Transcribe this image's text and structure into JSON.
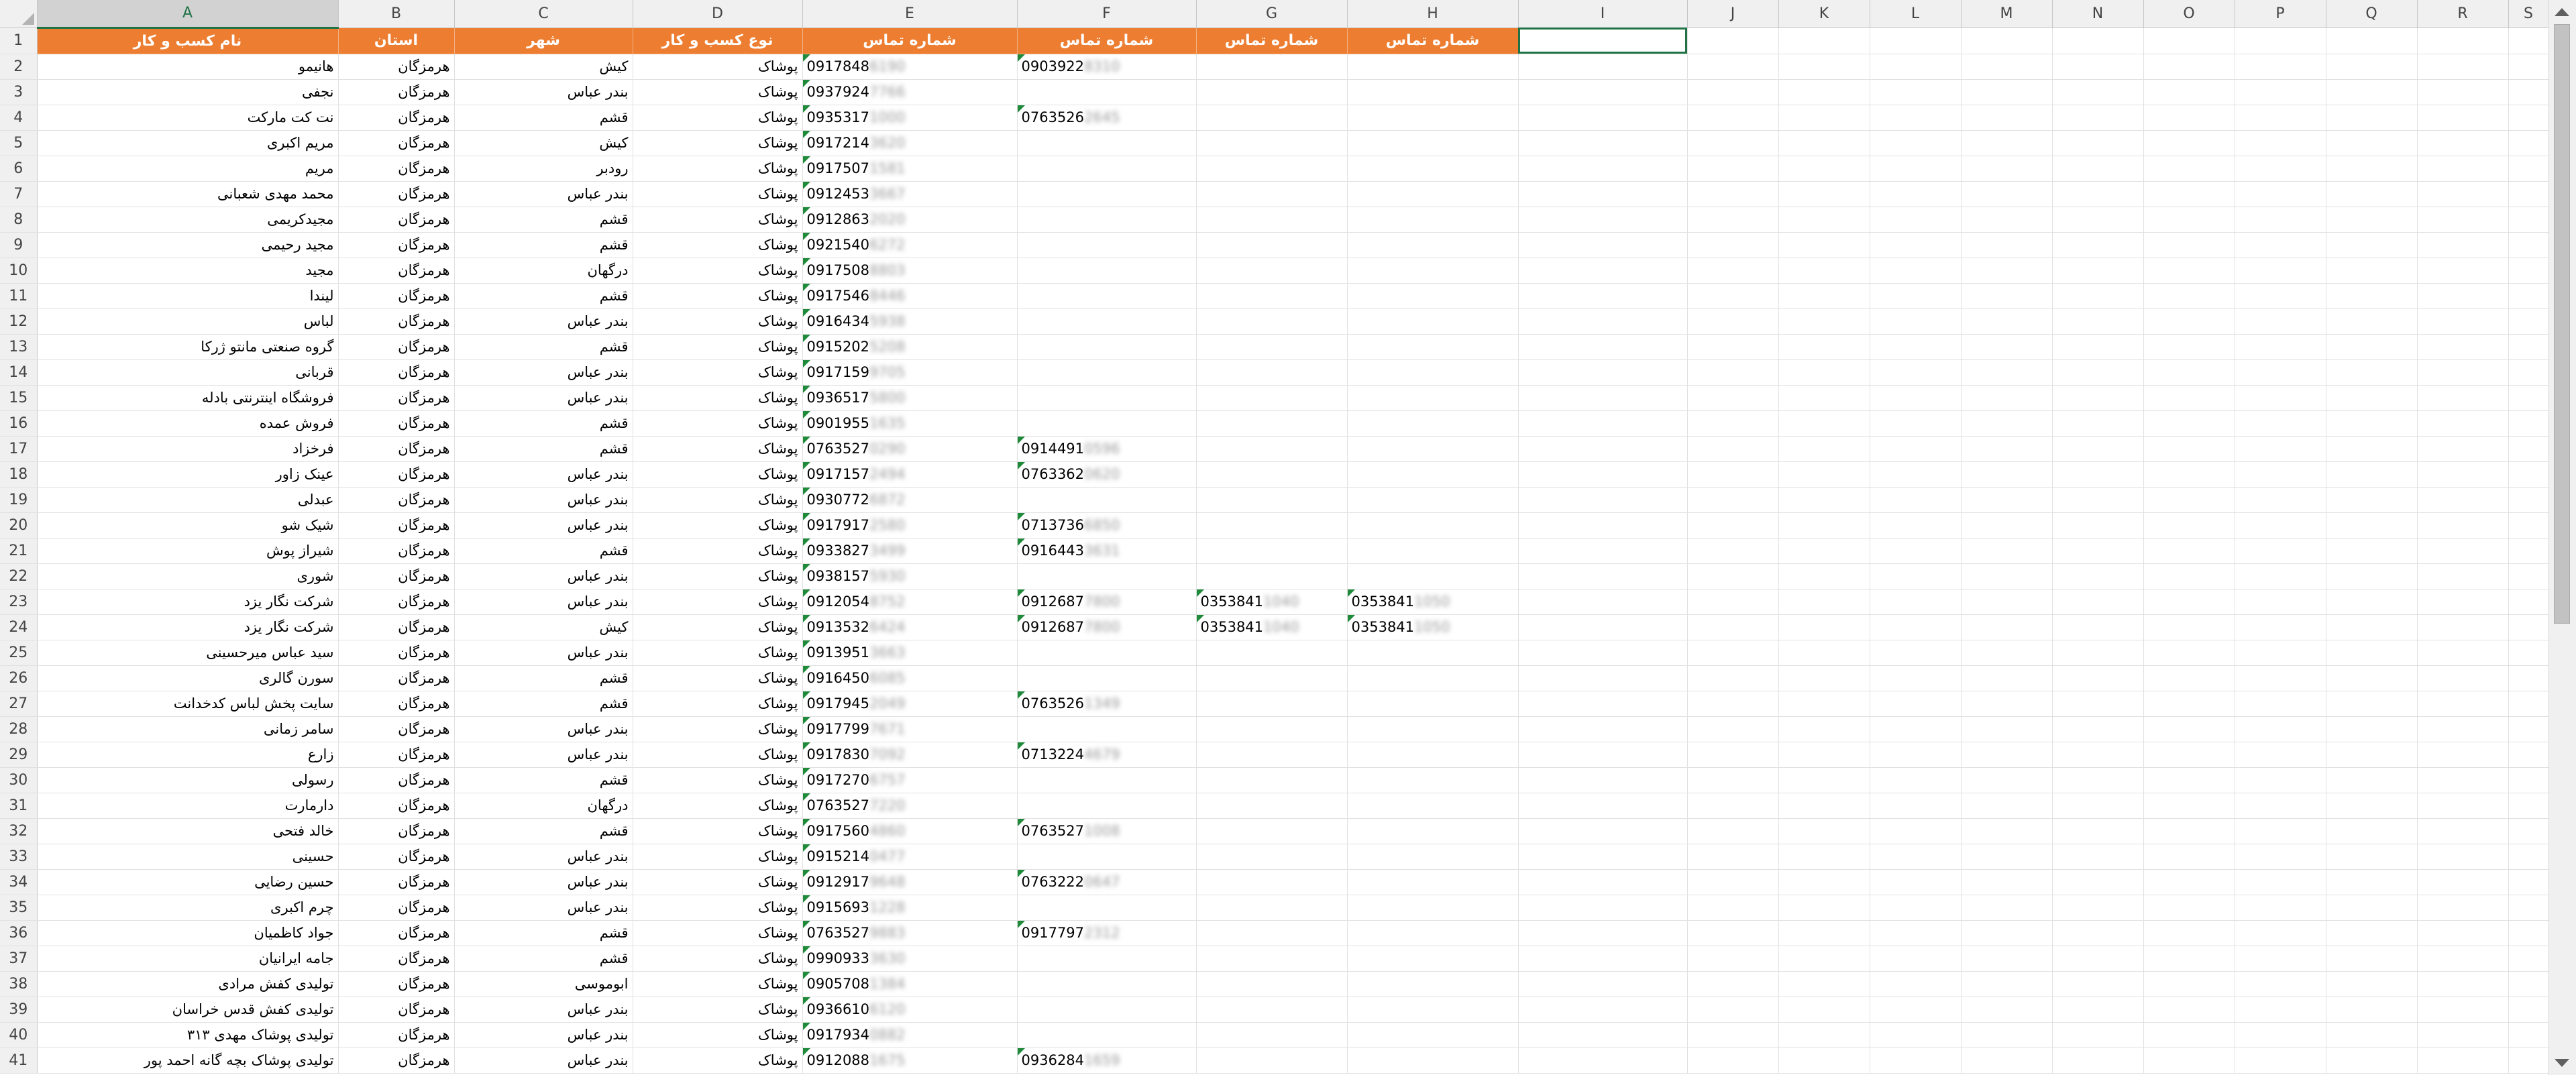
{
  "columns": [
    "A",
    "B",
    "C",
    "D",
    "E",
    "F",
    "G",
    "H",
    "I",
    "J",
    "K",
    "L",
    "M",
    "N",
    "O",
    "P",
    "Q",
    "R",
    "S"
  ],
  "selected_column": "A",
  "header_row": {
    "name": "نام کسب و کار",
    "province": "استان",
    "city": "شهر",
    "business_type": "نوع کسب و کار",
    "phone1": "شماره تماس",
    "phone2": "شماره تماس",
    "phone3": "شماره تماس",
    "phone4": "شماره تماس"
  },
  "rows": [
    {
      "n": "2",
      "name": "هانیمو",
      "province": "هرمزگان",
      "city": "کیش",
      "type": "پوشاک",
      "p1": "0917848",
      "p1h": "6190",
      "p2": "0903922",
      "p2h": "8310",
      "p3": "",
      "p3h": "",
      "p4": "",
      "p4h": ""
    },
    {
      "n": "3",
      "name": "نجفی",
      "province": "هرمزگان",
      "city": "بندر عباس",
      "type": "پوشاک",
      "p1": "0937924",
      "p1h": "7766",
      "p2": "",
      "p2h": "",
      "p3": "",
      "p3h": "",
      "p4": "",
      "p4h": ""
    },
    {
      "n": "4",
      "name": "نت کت مارکت",
      "province": "هرمزگان",
      "city": "قشم",
      "type": "پوشاک",
      "p1": "0935317",
      "p1h": "1000",
      "p2": "0763526",
      "p2h": "2645",
      "p3": "",
      "p3h": "",
      "p4": "",
      "p4h": ""
    },
    {
      "n": "5",
      "name": "مریم اکبری",
      "province": "هرمزگان",
      "city": "کیش",
      "type": "پوشاک",
      "p1": "0917214",
      "p1h": "3620",
      "p2": "",
      "p2h": "",
      "p3": "",
      "p3h": "",
      "p4": "",
      "p4h": ""
    },
    {
      "n": "6",
      "name": "مریم",
      "province": "هرمزگان",
      "city": "رودبر",
      "type": "پوشاک",
      "p1": "0917507",
      "p1h": "1581",
      "p2": "",
      "p2h": "",
      "p3": "",
      "p3h": "",
      "p4": "",
      "p4h": ""
    },
    {
      "n": "7",
      "name": "محمد مهدی شعبانی",
      "province": "هرمزگان",
      "city": "بندر عباس",
      "type": "پوشاک",
      "p1": "0912453",
      "p1h": "3667",
      "p2": "",
      "p2h": "",
      "p3": "",
      "p3h": "",
      "p4": "",
      "p4h": ""
    },
    {
      "n": "8",
      "name": "مجیدکریمی",
      "province": "هرمزگان",
      "city": "قشم",
      "type": "پوشاک",
      "p1": "0912863",
      "p1h": "2020",
      "p2": "",
      "p2h": "",
      "p3": "",
      "p3h": "",
      "p4": "",
      "p4h": ""
    },
    {
      "n": "9",
      "name": "مجید رحیمی",
      "province": "هرمزگان",
      "city": "قشم",
      "type": "پوشاک",
      "p1": "0921540",
      "p1h": "6272",
      "p2": "",
      "p2h": "",
      "p3": "",
      "p3h": "",
      "p4": "",
      "p4h": ""
    },
    {
      "n": "10",
      "name": "مجید",
      "province": "هرمزگان",
      "city": "درگهان",
      "type": "پوشاک",
      "p1": "0917508",
      "p1h": "8803",
      "p2": "",
      "p2h": "",
      "p3": "",
      "p3h": "",
      "p4": "",
      "p4h": ""
    },
    {
      "n": "11",
      "name": "لیندا",
      "province": "هرمزگان",
      "city": "قشم",
      "type": "پوشاک",
      "p1": "0917546",
      "p1h": "8446",
      "p2": "",
      "p2h": "",
      "p3": "",
      "p3h": "",
      "p4": "",
      "p4h": ""
    },
    {
      "n": "12",
      "name": "لباس",
      "province": "هرمزگان",
      "city": "بندر عباس",
      "type": "پوشاک",
      "p1": "0916434",
      "p1h": "5938",
      "p2": "",
      "p2h": "",
      "p3": "",
      "p3h": "",
      "p4": "",
      "p4h": ""
    },
    {
      "n": "13",
      "name": "گروه صنعتی مانتو ژرکا",
      "province": "هرمزگان",
      "city": "قشم",
      "type": "پوشاک",
      "p1": "0915202",
      "p1h": "5208",
      "p2": "",
      "p2h": "",
      "p3": "",
      "p3h": "",
      "p4": "",
      "p4h": ""
    },
    {
      "n": "14",
      "name": "قربانی",
      "province": "هرمزگان",
      "city": "بندر عباس",
      "type": "پوشاک",
      "p1": "0917159",
      "p1h": "9705",
      "p2": "",
      "p2h": "",
      "p3": "",
      "p3h": "",
      "p4": "",
      "p4h": ""
    },
    {
      "n": "15",
      "name": "فروشگاه اینترنتی بادله",
      "province": "هرمزگان",
      "city": "بندر عباس",
      "type": "پوشاک",
      "p1": "0936517",
      "p1h": "5800",
      "p2": "",
      "p2h": "",
      "p3": "",
      "p3h": "",
      "p4": "",
      "p4h": ""
    },
    {
      "n": "16",
      "name": "فروش عمده",
      "province": "هرمزگان",
      "city": "قشم",
      "type": "پوشاک",
      "p1": "0901955",
      "p1h": "1635",
      "p2": "",
      "p2h": "",
      "p3": "",
      "p3h": "",
      "p4": "",
      "p4h": ""
    },
    {
      "n": "17",
      "name": "فرخزاد",
      "province": "هرمزگان",
      "city": "قشم",
      "type": "پوشاک",
      "p1": "0763527",
      "p1h": "0290",
      "p2": "0914491",
      "p2h": "0596",
      "p3": "",
      "p3h": "",
      "p4": "",
      "p4h": ""
    },
    {
      "n": "18",
      "name": "عینک زاور",
      "province": "هرمزگان",
      "city": "بندر عباس",
      "type": "پوشاک",
      "p1": "0917157",
      "p1h": "2494",
      "p2": "0763362",
      "p2h": "0620",
      "p3": "",
      "p3h": "",
      "p4": "",
      "p4h": ""
    },
    {
      "n": "19",
      "name": "عبدلی",
      "province": "هرمزگان",
      "city": "بندر عباس",
      "type": "پوشاک",
      "p1": "0930772",
      "p1h": "6872",
      "p2": "",
      "p2h": "",
      "p3": "",
      "p3h": "",
      "p4": "",
      "p4h": ""
    },
    {
      "n": "20",
      "name": "شیک شو",
      "province": "هرمزگان",
      "city": "بندر عباس",
      "type": "پوشاک",
      "p1": "0917917",
      "p1h": "2580",
      "p2": "0713736",
      "p2h": "6850",
      "p3": "",
      "p3h": "",
      "p4": "",
      "p4h": ""
    },
    {
      "n": "21",
      "name": "شیراز پوش",
      "province": "هرمزگان",
      "city": "قشم",
      "type": "پوشاک",
      "p1": "0933827",
      "p1h": "3499",
      "p2": "0916443",
      "p2h": "3631",
      "p3": "",
      "p3h": "",
      "p4": "",
      "p4h": ""
    },
    {
      "n": "22",
      "name": "شوری",
      "province": "هرمزگان",
      "city": "بندر عباس",
      "type": "پوشاک",
      "p1": "0938157",
      "p1h": "5930",
      "p2": "",
      "p2h": "",
      "p3": "",
      "p3h": "",
      "p4": "",
      "p4h": ""
    },
    {
      "n": "23",
      "name": "شرکت نگار یزد",
      "province": "هرمزگان",
      "city": "بندر عباس",
      "type": "پوشاک",
      "p1": "0912054",
      "p1h": "8752",
      "p2": "0912687",
      "p2h": "7800",
      "p3": "0353841",
      "p3h": "1040",
      "p4": "0353841",
      "p4h": "1050"
    },
    {
      "n": "24",
      "name": "شرکت نگار یزد",
      "province": "هرمزگان",
      "city": "کیش",
      "type": "پوشاک",
      "p1": "0913532",
      "p1h": "6424",
      "p2": "0912687",
      "p2h": "7800",
      "p3": "0353841",
      "p3h": "1040",
      "p4": "0353841",
      "p4h": "1050"
    },
    {
      "n": "25",
      "name": "سید عباس میرحسینی",
      "province": "هرمزگان",
      "city": "بندر عباس",
      "type": "پوشاک",
      "p1": "0913951",
      "p1h": "3663",
      "p2": "",
      "p2h": "",
      "p3": "",
      "p3h": "",
      "p4": "",
      "p4h": ""
    },
    {
      "n": "26",
      "name": "سورن گالری",
      "province": "هرمزگان",
      "city": "قشم",
      "type": "پوشاک",
      "p1": "0916450",
      "p1h": "6085",
      "p2": "",
      "p2h": "",
      "p3": "",
      "p3h": "",
      "p4": "",
      "p4h": ""
    },
    {
      "n": "27",
      "name": "سایت پخش لباس کدخدانت",
      "province": "هرمزگان",
      "city": "قشم",
      "type": "پوشاک",
      "p1": "0917945",
      "p1h": "2049",
      "p2": "0763526",
      "p2h": "1349",
      "p3": "",
      "p3h": "",
      "p4": "",
      "p4h": ""
    },
    {
      "n": "28",
      "name": "سامر زمانی",
      "province": "هرمزگان",
      "city": "بندر عباس",
      "type": "پوشاک",
      "p1": "0917799",
      "p1h": "7671",
      "p2": "",
      "p2h": "",
      "p3": "",
      "p3h": "",
      "p4": "",
      "p4h": ""
    },
    {
      "n": "29",
      "name": "زارع",
      "province": "هرمزگان",
      "city": "بندر عباس",
      "type": "پوشاک",
      "p1": "0917830",
      "p1h": "7092",
      "p2": "0713224",
      "p2h": "4679",
      "p3": "",
      "p3h": "",
      "p4": "",
      "p4h": ""
    },
    {
      "n": "30",
      "name": "رسولی",
      "province": "هرمزگان",
      "city": "قشم",
      "type": "پوشاک",
      "p1": "0917270",
      "p1h": "6757",
      "p2": "",
      "p2h": "",
      "p3": "",
      "p3h": "",
      "p4": "",
      "p4h": ""
    },
    {
      "n": "31",
      "name": "دارمارت",
      "province": "هرمزگان",
      "city": "درگهان",
      "type": "پوشاک",
      "p1": "0763527",
      "p1h": "7220",
      "p2": "",
      "p2h": "",
      "p3": "",
      "p3h": "",
      "p4": "",
      "p4h": ""
    },
    {
      "n": "32",
      "name": "خالد فتحی",
      "province": "هرمزگان",
      "city": "قشم",
      "type": "پوشاک",
      "p1": "0917560",
      "p1h": "4860",
      "p2": "0763527",
      "p2h": "1008",
      "p3": "",
      "p3h": "",
      "p4": "",
      "p4h": ""
    },
    {
      "n": "33",
      "name": "حسینی",
      "province": "هرمزگان",
      "city": "بندر عباس",
      "type": "پوشاک",
      "p1": "0915214",
      "p1h": "0477",
      "p2": "",
      "p2h": "",
      "p3": "",
      "p3h": "",
      "p4": "",
      "p4h": ""
    },
    {
      "n": "34",
      "name": "حسین رضایی",
      "province": "هرمزگان",
      "city": "بندر عباس",
      "type": "پوشاک",
      "p1": "0912917",
      "p1h": "9648",
      "p2": "0763222",
      "p2h": "0647",
      "p3": "",
      "p3h": "",
      "p4": "",
      "p4h": ""
    },
    {
      "n": "35",
      "name": "چرم اکبری",
      "province": "هرمزگان",
      "city": "بندر عباس",
      "type": "پوشاک",
      "p1": "0915693",
      "p1h": "1228",
      "p2": "",
      "p2h": "",
      "p3": "",
      "p3h": "",
      "p4": "",
      "p4h": ""
    },
    {
      "n": "36",
      "name": "جواد کاظمیان",
      "province": "هرمزگان",
      "city": "قشم",
      "type": "پوشاک",
      "p1": "0763527",
      "p1h": "9883",
      "p2": "0917797",
      "p2h": "2312",
      "p3": "",
      "p3h": "",
      "p4": "",
      "p4h": ""
    },
    {
      "n": "37",
      "name": "جامه ایرانیان",
      "province": "هرمزگان",
      "city": "قشم",
      "type": "پوشاک",
      "p1": "0990933",
      "p1h": "3630",
      "p2": "",
      "p2h": "",
      "p3": "",
      "p3h": "",
      "p4": "",
      "p4h": ""
    },
    {
      "n": "38",
      "name": "تولیدی کفش مرادی",
      "province": "هرمزگان",
      "city": "ابوموسی",
      "type": "پوشاک",
      "p1": "0905708",
      "p1h": "1384",
      "p2": "",
      "p2h": "",
      "p3": "",
      "p3h": "",
      "p4": "",
      "p4h": ""
    },
    {
      "n": "39",
      "name": "تولیدی کفش قدس خراسان",
      "province": "هرمزگان",
      "city": "بندر عباس",
      "type": "پوشاک",
      "p1": "0936610",
      "p1h": "6120",
      "p2": "",
      "p2h": "",
      "p3": "",
      "p3h": "",
      "p4": "",
      "p4h": ""
    },
    {
      "n": "40",
      "name": "تولیدی پوشاک مهدی ۳۱۳",
      "province": "هرمزگان",
      "city": "بندر عباس",
      "type": "پوشاک",
      "p1": "0917934",
      "p1h": "0882",
      "p2": "",
      "p2h": "",
      "p3": "",
      "p3h": "",
      "p4": "",
      "p4h": ""
    },
    {
      "n": "41",
      "name": "تولیدی پوشاک بچه گانه احمد پور",
      "province": "هرمزگان",
      "city": "بندر عباس",
      "type": "پوشاک",
      "p1": "0912088",
      "p1h": "1675",
      "p2": "0936284",
      "p2h": "1659",
      "p3": "",
      "p3h": "",
      "p4": "",
      "p4h": ""
    }
  ],
  "colors": {
    "header_fill": "#ed7d31",
    "header_text": "#ffffff",
    "selection": "#217346",
    "text_flag": "#1f8a3a"
  }
}
